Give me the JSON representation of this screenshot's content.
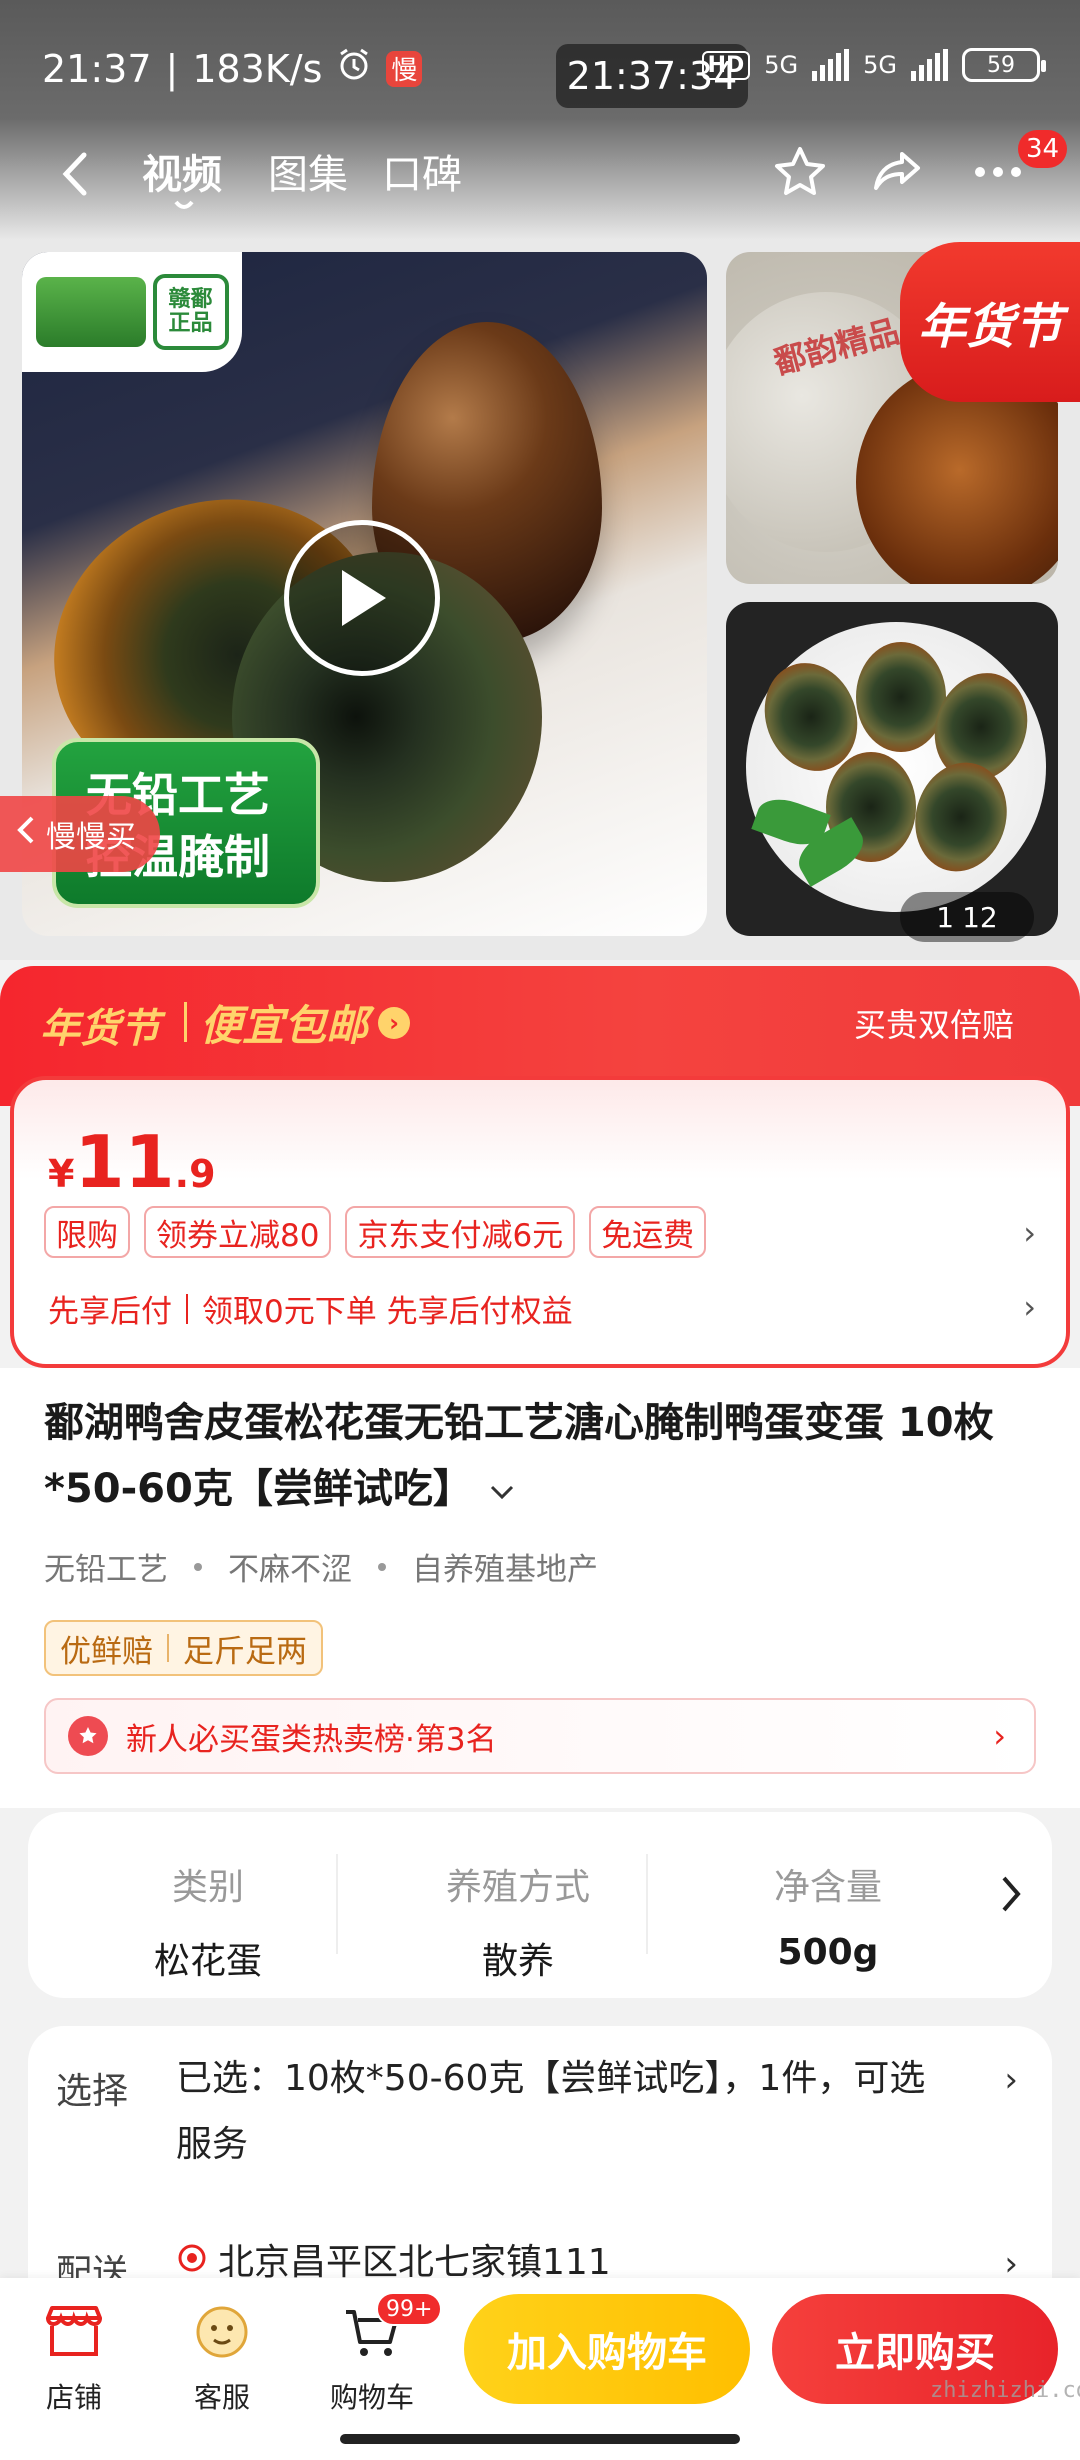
{
  "status_bar": {
    "time": "21:37",
    "net_speed": "183K/s",
    "slow_badge": "慢",
    "center_clock": "21:37:34",
    "hd": "HD",
    "signal1": "5G",
    "signal2": "5G",
    "battery": "59"
  },
  "nav": {
    "tabs": [
      "视频",
      "图集",
      "口碑"
    ],
    "active_tab": "视频",
    "message_count": "34"
  },
  "gallery": {
    "seal_line1": "赣鄱",
    "seal_line2": "正品",
    "banner_line1": "无铅工艺",
    "banner_line2": "控温腌制",
    "slow_buy": "慢慢买",
    "thumb_stamp": "鄱韵精品",
    "festival_tag": "年货节",
    "index_current": "1",
    "index_total": "12"
  },
  "promo": {
    "brand": "年货节",
    "title": "便宜包邮",
    "right_text": "买贵双倍赔"
  },
  "price": {
    "currency": "¥",
    "integer": "11",
    "decimal": ".9",
    "chips": [
      "限购",
      "领券立减80",
      "京东支付减6元",
      "免运费"
    ],
    "later_pay_a": "先享后付",
    "later_pay_b": "领取0元下单 先享后付权益"
  },
  "product": {
    "title": "鄱湖鸭舍皮蛋松花蛋无铅工艺溏心腌制鸭蛋变蛋 10枚*50-60克【尝鲜试吃】",
    "features": [
      "无铅工艺",
      "不麻不涩",
      "自养殖基地产"
    ],
    "service_tags": [
      "优鲜赔",
      "足斤足两"
    ],
    "rank_text": "新人必买蛋类热卖榜·第3名"
  },
  "specs": [
    {
      "key": "类别",
      "value": "松花蛋"
    },
    {
      "key": "养殖方式",
      "value": "散养"
    },
    {
      "key": "净含量",
      "value": "500g"
    }
  ],
  "selection": {
    "select_label": "选择",
    "select_value": "已选：10枚*50-60克【尝鲜试吃】，1件，可选服务",
    "ship_label": "配送",
    "ship_value": "北京昌平区北七家镇111"
  },
  "bottom_bar": {
    "shop": "店铺",
    "service": "客服",
    "cart": "购物车",
    "cart_badge": "99+",
    "add_cart": "加入购物车",
    "buy_now": "立即购买"
  },
  "watermark": "zhizhizhi.com",
  "colors": {
    "accent_red": "#e8231f",
    "gold": "#ffd36b",
    "cart_yellow": "#ffc400"
  }
}
